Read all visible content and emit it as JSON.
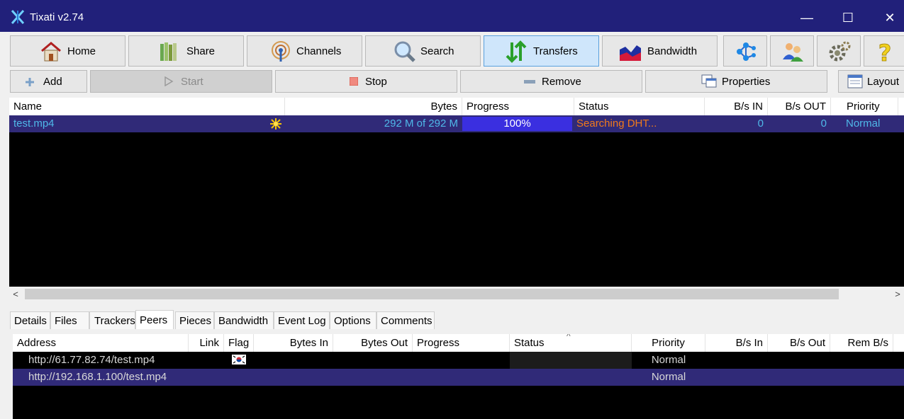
{
  "window": {
    "title": "Tixati v2.74",
    "minimize": "—",
    "maximize": "☐",
    "close": "✕"
  },
  "toolbar": [
    {
      "label": "Home",
      "icon": "home-icon"
    },
    {
      "label": "Share",
      "icon": "books-icon"
    },
    {
      "label": "Channels",
      "icon": "antenna-icon"
    },
    {
      "label": "Search",
      "icon": "magnifier-icon"
    },
    {
      "label": "Transfers",
      "icon": "up-down-arrows-icon",
      "active": true
    },
    {
      "label": "Bandwidth",
      "icon": "bandwidth-graph-icon"
    }
  ],
  "toolbar_icons": [
    "network-icon",
    "users-icon",
    "gears-icon",
    "help-icon"
  ],
  "actions": {
    "add": "Add",
    "start": "Start",
    "stop": "Stop",
    "remove": "Remove",
    "properties": "Properties",
    "layout": "Layout"
  },
  "transfers": {
    "columns": [
      "Name",
      "Bytes",
      "Progress",
      "Status",
      "B/s IN",
      "B/s OUT",
      "Priority"
    ],
    "rows": [
      {
        "name": "test.mp4",
        "bytes": "292 M of 292 M",
        "progress": "100%",
        "progress_fraction": 1.0,
        "status": "Searching DHT...",
        "bs_in": "0",
        "bs_out": "0",
        "priority": "Normal"
      }
    ]
  },
  "scroll": {
    "left": "<",
    "right": ">"
  },
  "detail_tabs": [
    "Details",
    "Files",
    "Trackers",
    "Peers",
    "Pieces",
    "Bandwidth",
    "Event Log",
    "Options",
    "Comments"
  ],
  "active_tab": "Peers",
  "peers": {
    "columns": [
      "Address",
      "Link",
      "Flag",
      "Bytes In",
      "Bytes Out",
      "Progress",
      "Status",
      "Priority",
      "B/s In",
      "B/s Out",
      "Rem B/s"
    ],
    "sort_indicator": "^",
    "rows": [
      {
        "address": "http://61.77.82.74/test.mp4",
        "flag": "korea-flag-icon",
        "priority": "Normal"
      },
      {
        "address": "http://192.168.1.100/test.mp4",
        "flag": "",
        "priority": "Normal"
      }
    ]
  },
  "colors": {
    "titlebar": "#21207a",
    "selected_row": "#302a78",
    "progress_fill": "#3a2fe0",
    "name_text": "#4fb8e8",
    "status_text": "#f07a1c",
    "priority_text": "#4fb8e8"
  }
}
